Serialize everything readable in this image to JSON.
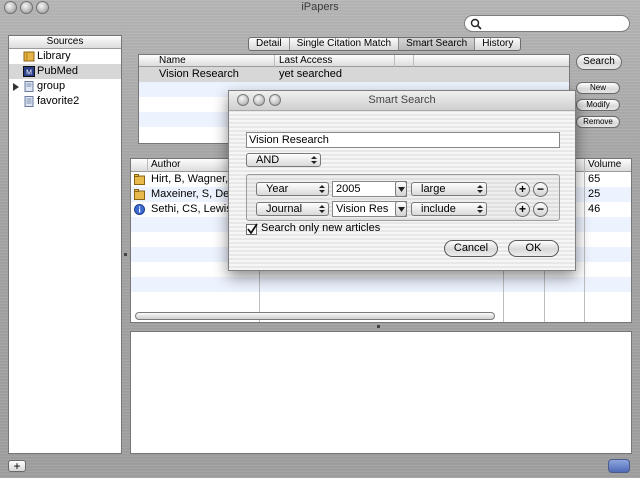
{
  "window": {
    "title": "iPapers"
  },
  "search": {
    "placeholder": ""
  },
  "sources": {
    "header": "Sources",
    "items": [
      {
        "label": "Library",
        "icon": "library-icon"
      },
      {
        "label": "PubMed",
        "icon": "pubmed-icon",
        "selected": true
      },
      {
        "label": "group",
        "icon": "group-icon"
      },
      {
        "label": "favorite2",
        "icon": "document-icon"
      }
    ]
  },
  "tabs": [
    {
      "label": "Detail"
    },
    {
      "label": "Single Citation Match"
    },
    {
      "label": "Smart Search",
      "selected": true
    },
    {
      "label": "History"
    }
  ],
  "search_list": {
    "columns": [
      "Name",
      "Last Access"
    ],
    "rows": [
      {
        "name": "Vision Research",
        "last_access": "yet searched"
      }
    ]
  },
  "buttons": {
    "search": "Search",
    "new": "New",
    "modify": "Modify",
    "remove": "Remove"
  },
  "articles": {
    "columns": {
      "author": "Author",
      "volume": "Volume"
    },
    "rows": [
      {
        "author": "Hirt, B, Wagner, H",
        "volume": "65",
        "icon": "folder-icon"
      },
      {
        "author": "Maxeiner, S, Ded",
        "volume": "25",
        "icon": "folder-icon"
      },
      {
        "author": "Sethi, CS, Lewis, G",
        "volume": "46",
        "icon": "info-icon"
      }
    ]
  },
  "dialog": {
    "title": "Smart Search",
    "name_value": "Vision Research",
    "operator": "AND",
    "criteria": [
      {
        "field": "Year",
        "value": "2005",
        "modifier": "large"
      },
      {
        "field": "Journal",
        "value": "Vision Res",
        "modifier": "include"
      }
    ],
    "checkbox_label": "Search only new articles",
    "checkbox_checked": true,
    "cancel": "Cancel",
    "ok": "OK"
  },
  "colors": {
    "selection": "#d7d7d7",
    "alt_row": "#edf3fe",
    "metal": "#a8a8a8"
  }
}
